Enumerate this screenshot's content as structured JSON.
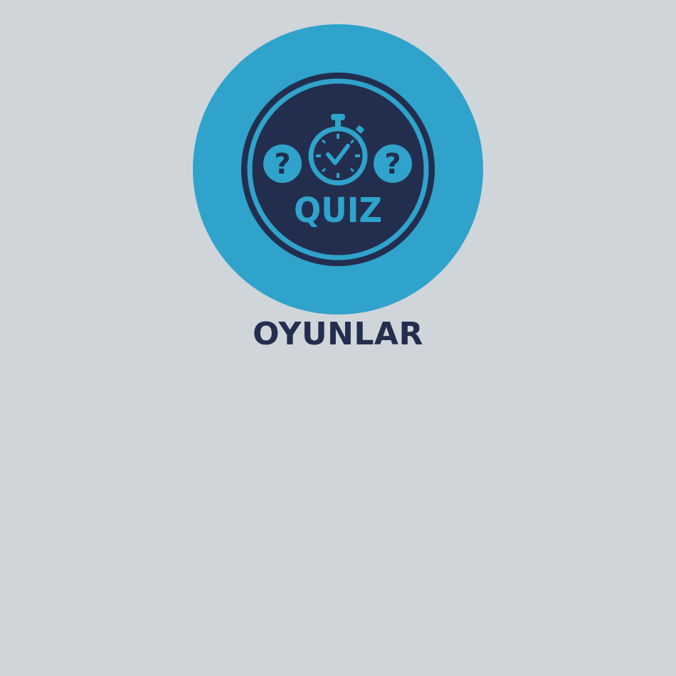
{
  "tile": {
    "logo_text": "QUIZ",
    "logo_icon": "quiz-stopwatch-icon",
    "caption": "OYUNLAR"
  },
  "colors": {
    "background": "#d0d5da",
    "accent": "#2fa3cb",
    "navy": "#232e4e"
  }
}
